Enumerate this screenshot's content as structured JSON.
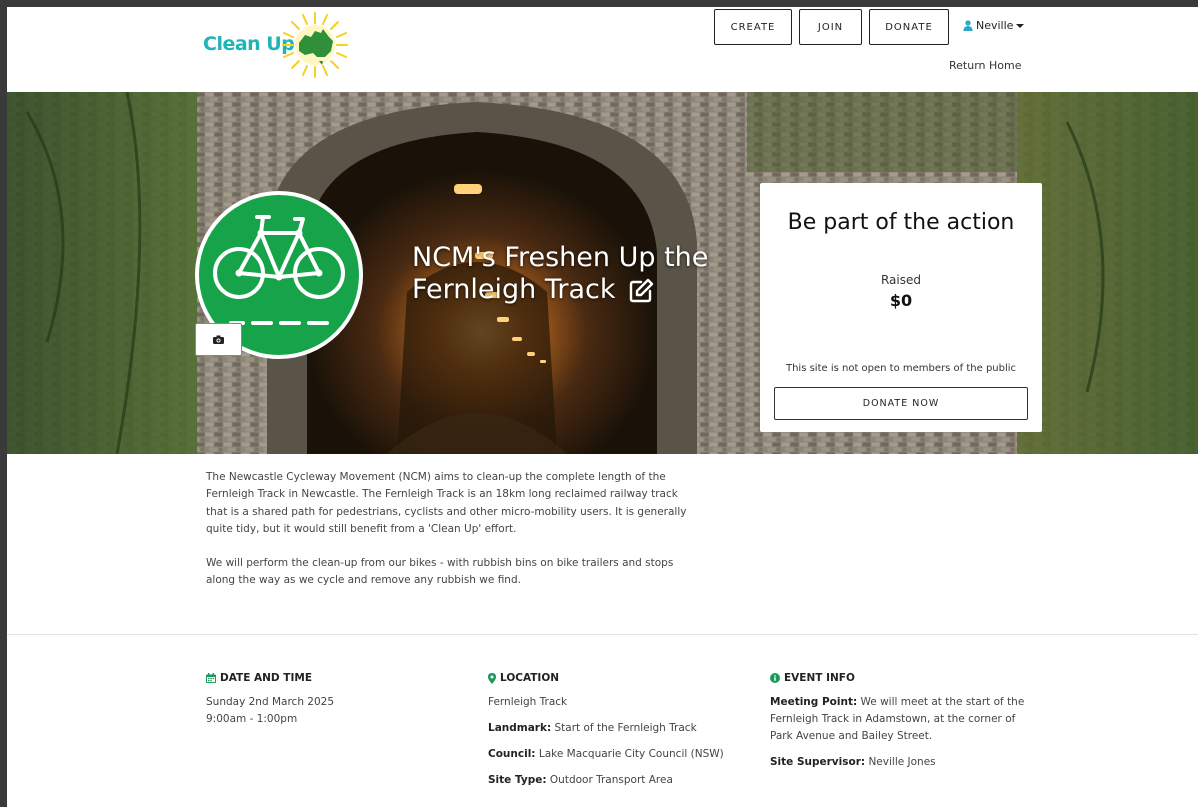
{
  "header": {
    "logo_text": "Clean Up",
    "nav": {
      "create": "CREATE",
      "join": "JOIN",
      "donate": "DONATE"
    },
    "user_name": "Neville",
    "return_link": "Return Home"
  },
  "hero": {
    "title": "NCM's Freshen Up the Fernleigh Track"
  },
  "action_card": {
    "heading": "Be part of the action",
    "raised_label": "Raised",
    "raised_value": "$0",
    "note": "This site is not open to members of the public",
    "donate_button": "DONATE NOW"
  },
  "description": {
    "paragraph_1": "The Newcastle Cycleway Movement (NCM) aims to clean-up the complete length of the Fernleigh Track in Newcastle. The Fernleigh Track is an 18km long reclaimed railway track that is a shared path for pedestrians, cyclists and other micro-mobility users. It is generally quite tidy, but it would still benefit from a 'Clean Up' effort.",
    "paragraph_2": "We will perform the clean-up from our bikes - with rubbish bins on bike trailers and stops along the way as we cycle and remove any rubbish we find."
  },
  "date_time": {
    "heading": "DATE AND TIME",
    "date": "Sunday 2nd March 2025",
    "time": "9:00am - 1:00pm"
  },
  "location": {
    "heading": "LOCATION",
    "name": "Fernleigh Track",
    "landmark_label": "Landmark:",
    "landmark_value": "Start of the Fernleigh Track",
    "council_label": "Council:",
    "council_value": "Lake Macquarie City Council (NSW)",
    "site_type_label": "Site Type:",
    "site_type_value": "Outdoor Transport Area"
  },
  "event_info": {
    "heading": "EVENT INFO",
    "meeting_label": "Meeting Point:",
    "meeting_value": "We will meet at the start of the Fernleigh Track in Adamstown, at the corner of Park Avenue and Bailey Street.",
    "supervisor_label": "Site Supervisor:",
    "supervisor_value": "Neville Jones"
  },
  "colors": {
    "brand_teal": "#1fb5b6",
    "event_green": "#16a34a",
    "heading_green": "#1a9a5a"
  }
}
